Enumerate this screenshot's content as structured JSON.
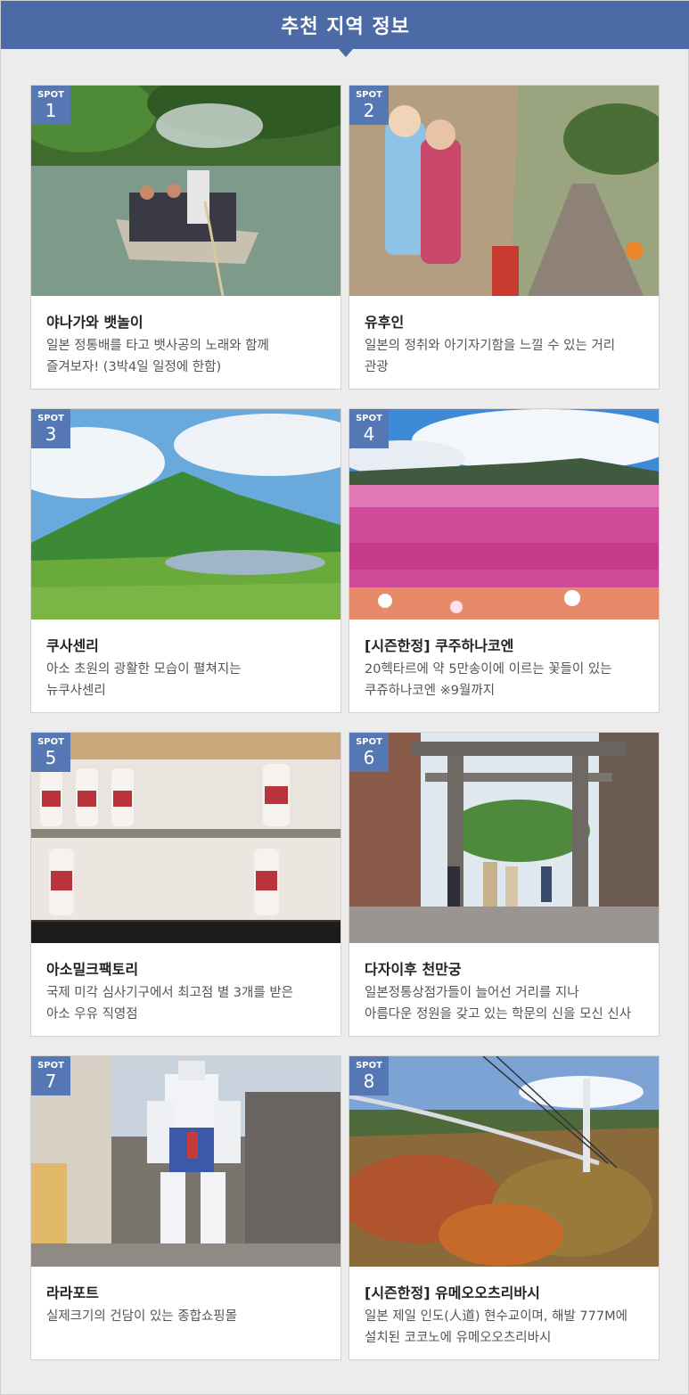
{
  "header": {
    "title": "추천 지역 정보"
  },
  "spot_label": "SPOT",
  "colors": {
    "header_bg": "#4b6aa6",
    "badge_bg": "#5577b3",
    "page_bg": "#ececec"
  },
  "spots": [
    {
      "num": "1",
      "title": "야나가와 뱃놀이",
      "desc1": "일본 정통배를 타고 뱃사공의 노래와 함께",
      "desc2": "즐겨보자! (3박4일 일정에 한함)"
    },
    {
      "num": "2",
      "title": "유후인",
      "desc1": "일본의 정취와 아기자기함을 느낄 수 있는 거리",
      "desc2": "관광"
    },
    {
      "num": "3",
      "title": "쿠사센리",
      "desc1": "아소 초원의 광활한 모습이 펼쳐지는",
      "desc2": "뉴쿠사센리"
    },
    {
      "num": "4",
      "title": "[시즌한정] 쿠주하나코엔",
      "desc1": " 20헥타르에 약 5만송이에 이르는 꽃들이 있는",
      "desc2": "쿠쥬하나코엔  ※9월까지"
    },
    {
      "num": "5",
      "title": "아소밀크팩토리",
      "desc1": "국제 미각 심사기구에서 최고점 별 3개를 받은",
      "desc2": "아소 우유 직영점"
    },
    {
      "num": "6",
      "title": "다자이후 천만궁",
      "desc1": "일본정통상점가들이 늘어선 거리를 지나",
      "desc2": "아름다운 정원을 갖고 있는 학문의 신을 모신 신사"
    },
    {
      "num": "7",
      "title": "라라포트",
      "desc1": "실제크기의 건담이 있는 종합쇼핑몰",
      "desc2": ""
    },
    {
      "num": "8",
      "title": "[시즌한정] 유메오오츠리바시",
      "desc1": "일본 제일 인도(人道) 현수교이며, 해발 777M에",
      "desc2": "설치된 코코노에 유메오오츠리바시"
    }
  ]
}
